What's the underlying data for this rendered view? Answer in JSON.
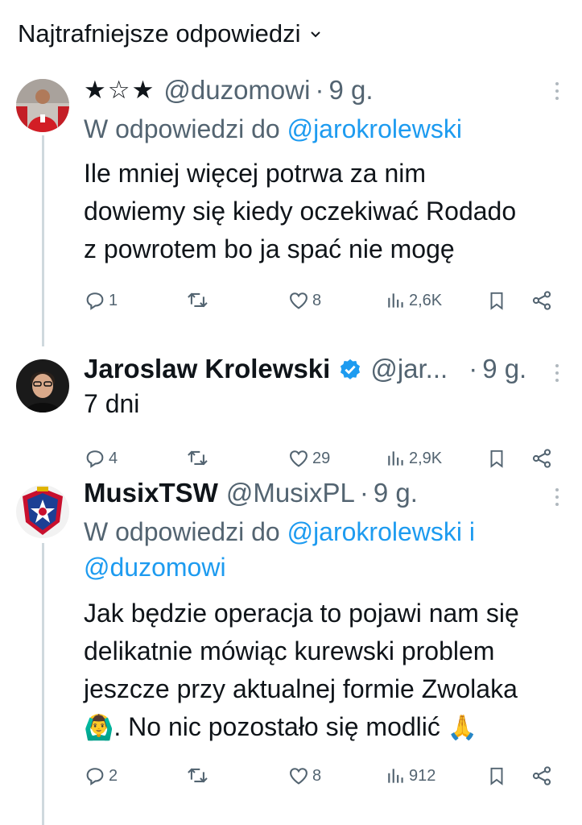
{
  "header": {
    "title": "Najtrafniejsze odpowiedzi"
  },
  "tweets": [
    {
      "stars": "★☆★",
      "handle": "@duzomowi",
      "time": "9 g.",
      "reply_prefix": "W odpowiedzi do ",
      "reply_mention": "@jarokrolewski",
      "text": "Ile mniej więcej potrwa za nim dowiemy się kiedy oczekiwać Rodado z powrotem bo ja spać nie mogę",
      "replies": "1",
      "reposts": "",
      "likes": "8",
      "views": "2,6K"
    },
    {
      "name": "Jaroslaw Krolewski",
      "handle": "@jar...",
      "time": "9 g.",
      "text": "7 dni",
      "replies": "4",
      "reposts": "",
      "likes": "29",
      "views": "2,9K"
    },
    {
      "name": "MusixTSW",
      "handle": "@MusixPL",
      "time": "9 g.",
      "reply_prefix": "W odpowiedzi do ",
      "reply_mention": "@jarokrolewski i",
      "reply_mention2": "@duzomowi",
      "text": "Jak będzie operacja to pojawi nam się delikatnie mówiąc kurewski problem jeszcze przy aktualnej formie Zwolaka",
      "emoji1": "🙆‍♂️",
      "text2": ". No nic pozostało się modlić ",
      "emoji2": "🙏",
      "replies": "2",
      "reposts": "",
      "likes": "8",
      "views": "912"
    }
  ],
  "colors": {
    "accent": "#1d9bf0",
    "secondary": "#536471",
    "text": "#0f1419",
    "thread": "#cfd9de"
  }
}
